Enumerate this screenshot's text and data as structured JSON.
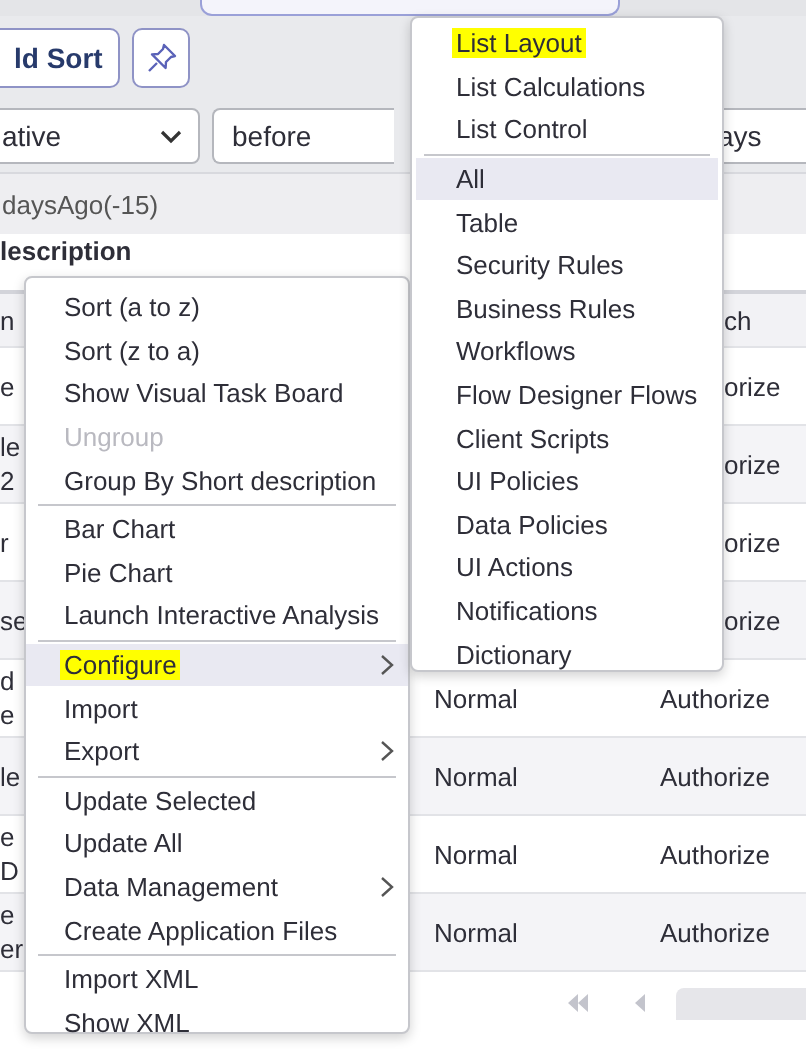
{
  "toolbar": {
    "sort_button": "ld Sort"
  },
  "filter": {
    "operator": "ative",
    "relation": "before",
    "value": "ays"
  },
  "condition": "daysAgo(-15)",
  "group_heading": "lescription",
  "table": {
    "columns": [
      {
        "label": "n"
      },
      {},
      {
        "label": "ch"
      }
    ],
    "rows": [
      {
        "column_1": [
          "e"
        ],
        "column_3": "orize"
      },
      {
        "column_1": [
          "le",
          "2"
        ],
        "column_3": "orize"
      },
      {
        "column_1": [
          "r"
        ],
        "column_3": "orize"
      },
      {
        "column_1": [
          "se"
        ],
        "column_3": "orize"
      },
      {
        "column_1": [
          "d",
          "e"
        ],
        "column_2": "Normal",
        "column_3": "Authorize"
      },
      {
        "column_1": [
          "le"
        ],
        "column_2": "Normal",
        "column_3": "Authorize"
      },
      {
        "column_1": [
          "e",
          "D"
        ],
        "column_2": "Normal",
        "column_3": "Authorize"
      },
      {
        "column_1": [
          "e",
          "er"
        ],
        "column_2": "Normal",
        "column_3": "Authorize"
      }
    ]
  },
  "context_menu": {
    "items": [
      {
        "kind": "item",
        "label": "Sort (a to z)",
        "disabled": false,
        "selected": false,
        "highlighted": false,
        "submenu": false
      },
      {
        "kind": "item",
        "label": "Sort (z to a)",
        "disabled": false,
        "selected": false,
        "highlighted": false,
        "submenu": false
      },
      {
        "kind": "item",
        "label": "Show Visual Task Board",
        "disabled": false,
        "selected": false,
        "highlighted": false,
        "submenu": false
      },
      {
        "kind": "item",
        "label": "Ungroup",
        "disabled": true,
        "selected": false,
        "highlighted": false,
        "submenu": false
      },
      {
        "kind": "item",
        "label": "Group By Short description",
        "disabled": false,
        "selected": false,
        "highlighted": false,
        "submenu": false
      },
      {
        "kind": "separator"
      },
      {
        "kind": "item",
        "label": "Bar Chart",
        "disabled": false,
        "selected": false,
        "highlighted": false,
        "submenu": false
      },
      {
        "kind": "item",
        "label": "Pie Chart",
        "disabled": false,
        "selected": false,
        "highlighted": false,
        "submenu": false
      },
      {
        "kind": "item",
        "label": "Launch Interactive Analysis",
        "disabled": false,
        "selected": false,
        "highlighted": false,
        "submenu": false
      },
      {
        "kind": "separator"
      },
      {
        "kind": "item",
        "label": "Configure",
        "disabled": false,
        "selected": true,
        "highlighted": true,
        "submenu": true
      },
      {
        "kind": "item",
        "label": "Import",
        "disabled": false,
        "selected": false,
        "highlighted": false,
        "submenu": false
      },
      {
        "kind": "item",
        "label": "Export",
        "disabled": false,
        "selected": false,
        "highlighted": false,
        "submenu": true
      },
      {
        "kind": "separator"
      },
      {
        "kind": "item",
        "label": "Update Selected",
        "disabled": false,
        "selected": false,
        "highlighted": false,
        "submenu": false
      },
      {
        "kind": "item",
        "label": "Update All",
        "disabled": false,
        "selected": false,
        "highlighted": false,
        "submenu": false
      },
      {
        "kind": "item",
        "label": "Data Management",
        "disabled": false,
        "selected": false,
        "highlighted": false,
        "submenu": true
      },
      {
        "kind": "item",
        "label": "Create Application Files",
        "disabled": false,
        "selected": false,
        "highlighted": false,
        "submenu": false
      },
      {
        "kind": "separator"
      },
      {
        "kind": "item",
        "label": "Import XML",
        "disabled": false,
        "selected": false,
        "highlighted": false,
        "submenu": false
      },
      {
        "kind": "item",
        "label": "Show XML",
        "disabled": false,
        "selected": false,
        "highlighted": false,
        "submenu": false
      }
    ]
  },
  "submenu": {
    "items": [
      {
        "kind": "item",
        "label": "List Layout",
        "disabled": false,
        "selected": false,
        "highlighted": true,
        "submenu": false
      },
      {
        "kind": "item",
        "label": "List Calculations",
        "disabled": false,
        "selected": false,
        "highlighted": false,
        "submenu": false
      },
      {
        "kind": "item",
        "label": "List Control",
        "disabled": false,
        "selected": false,
        "highlighted": false,
        "submenu": false
      },
      {
        "kind": "separator"
      },
      {
        "kind": "item",
        "label": "All",
        "disabled": false,
        "selected": true,
        "highlighted": false,
        "submenu": false
      },
      {
        "kind": "item",
        "label": "Table",
        "disabled": false,
        "selected": false,
        "highlighted": false,
        "submenu": false
      },
      {
        "kind": "item",
        "label": "Security Rules",
        "disabled": false,
        "selected": false,
        "highlighted": false,
        "submenu": false
      },
      {
        "kind": "item",
        "label": "Business Rules",
        "disabled": false,
        "selected": false,
        "highlighted": false,
        "submenu": false
      },
      {
        "kind": "item",
        "label": "Workflows",
        "disabled": false,
        "selected": false,
        "highlighted": false,
        "submenu": false
      },
      {
        "kind": "item",
        "label": "Flow Designer Flows",
        "disabled": false,
        "selected": false,
        "highlighted": false,
        "submenu": false
      },
      {
        "kind": "item",
        "label": "Client Scripts",
        "disabled": false,
        "selected": false,
        "highlighted": false,
        "submenu": false
      },
      {
        "kind": "item",
        "label": "UI Policies",
        "disabled": false,
        "selected": false,
        "highlighted": false,
        "submenu": false
      },
      {
        "kind": "item",
        "label": "Data Policies",
        "disabled": false,
        "selected": false,
        "highlighted": false,
        "submenu": false
      },
      {
        "kind": "item",
        "label": "UI Actions",
        "disabled": false,
        "selected": false,
        "highlighted": false,
        "submenu": false
      },
      {
        "kind": "item",
        "label": "Notifications",
        "disabled": false,
        "selected": false,
        "highlighted": false,
        "submenu": false
      },
      {
        "kind": "item",
        "label": "Dictionary",
        "disabled": false,
        "selected": false,
        "highlighted": false,
        "submenu": false
      }
    ]
  }
}
